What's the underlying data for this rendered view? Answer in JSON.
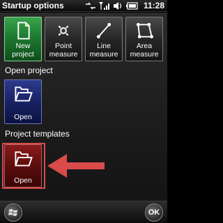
{
  "statusbar": {
    "title": "Startup options",
    "time": "11:28",
    "icons": [
      "connectivity-icon",
      "signal-icon",
      "volume-icon",
      "battery-icon"
    ]
  },
  "tiles": {
    "new_project": "New project",
    "point_measure": "Point measure",
    "line_measure": "Line measure",
    "area_measure": "Area measure",
    "open_project": "Open",
    "open_template": "Open"
  },
  "sections": {
    "open_project": "Open project",
    "project_templates": "Project templates"
  },
  "softkeys": {
    "ok": "OK"
  },
  "colors": {
    "new_tile": "#1f7a31",
    "measure_tile": "#262626",
    "open_project_tile": "#1a2467",
    "template_tile": "#5c0c0c",
    "annotation": "#d94b4b"
  }
}
